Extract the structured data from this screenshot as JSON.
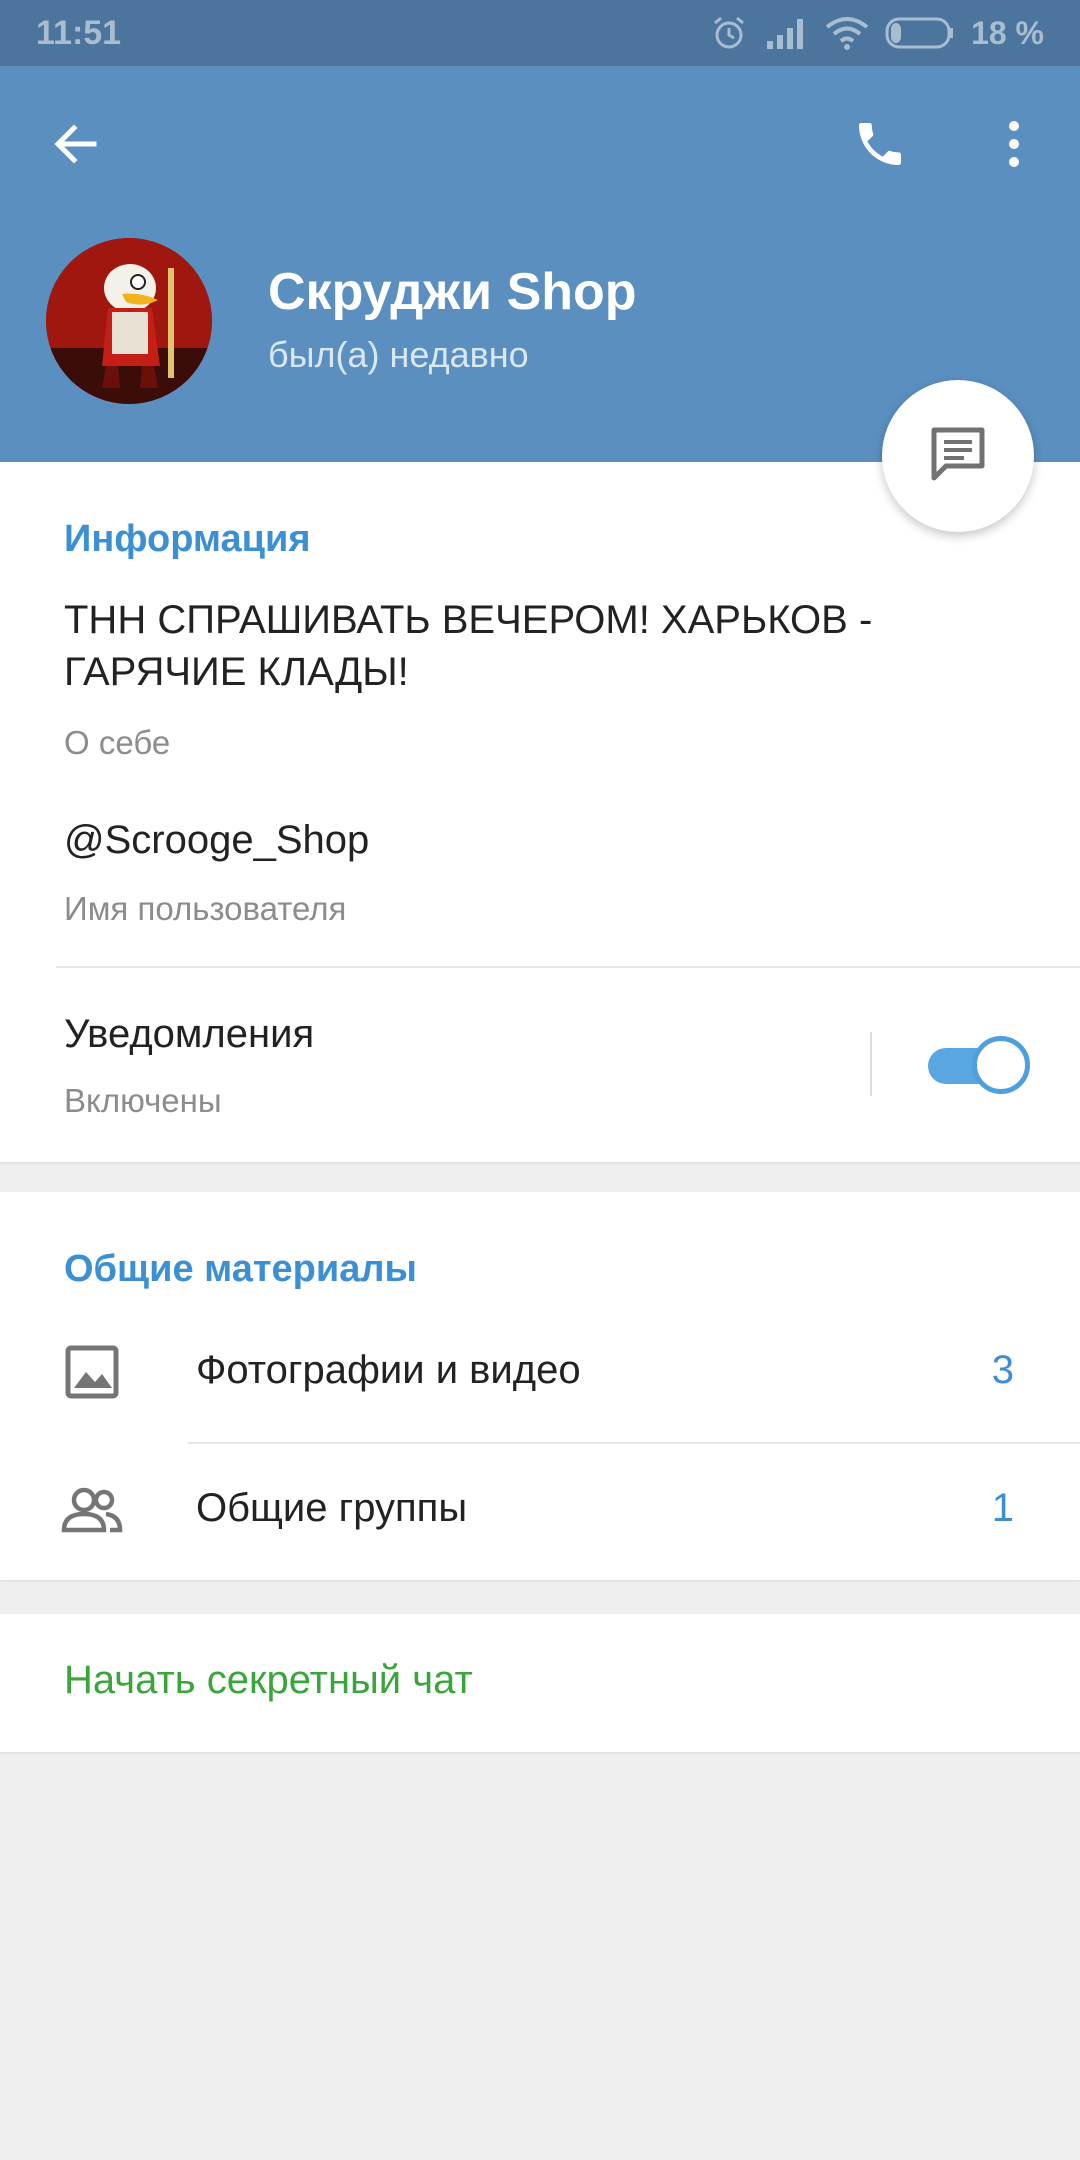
{
  "status_bar": {
    "time": "11:51",
    "battery_percent": "18 %",
    "icons": [
      "alarm-icon",
      "signal-icon",
      "wifi-icon",
      "battery-icon"
    ]
  },
  "header": {
    "name": "Скруджи Shop",
    "status": "был(а) недавно",
    "icons": [
      "back-arrow-icon",
      "phone-icon",
      "more-vert-icon",
      "message-icon"
    ],
    "background_color": "#5a8fbf"
  },
  "info": {
    "section_title": "Информация",
    "bio_line1": "ТНН СПРАШИВАТЬ ВЕЧЕРОМ! ХАРЬКОВ -",
    "bio_line2": "ГАРЯЧИЕ КЛАДЫ!",
    "bio_caption": "О себе",
    "username": "@Scrooge_Shop",
    "username_caption": "Имя пользователя",
    "notifications_label": "Уведомления",
    "notifications_status": "Включены",
    "notifications_enabled": true
  },
  "shared": {
    "section_title": "Общие материалы",
    "items": [
      {
        "icon": "image-icon",
        "label": "Фотографии и видео",
        "count": "3"
      },
      {
        "icon": "group-icon",
        "label": "Общие группы",
        "count": "1"
      }
    ]
  },
  "secret_chat": {
    "label": "Начать секретный чат",
    "color": "#3aa53a"
  },
  "colors": {
    "accent": "#3d8fd3",
    "header": "#5a8fbf",
    "status_bar": "#4b759c"
  }
}
